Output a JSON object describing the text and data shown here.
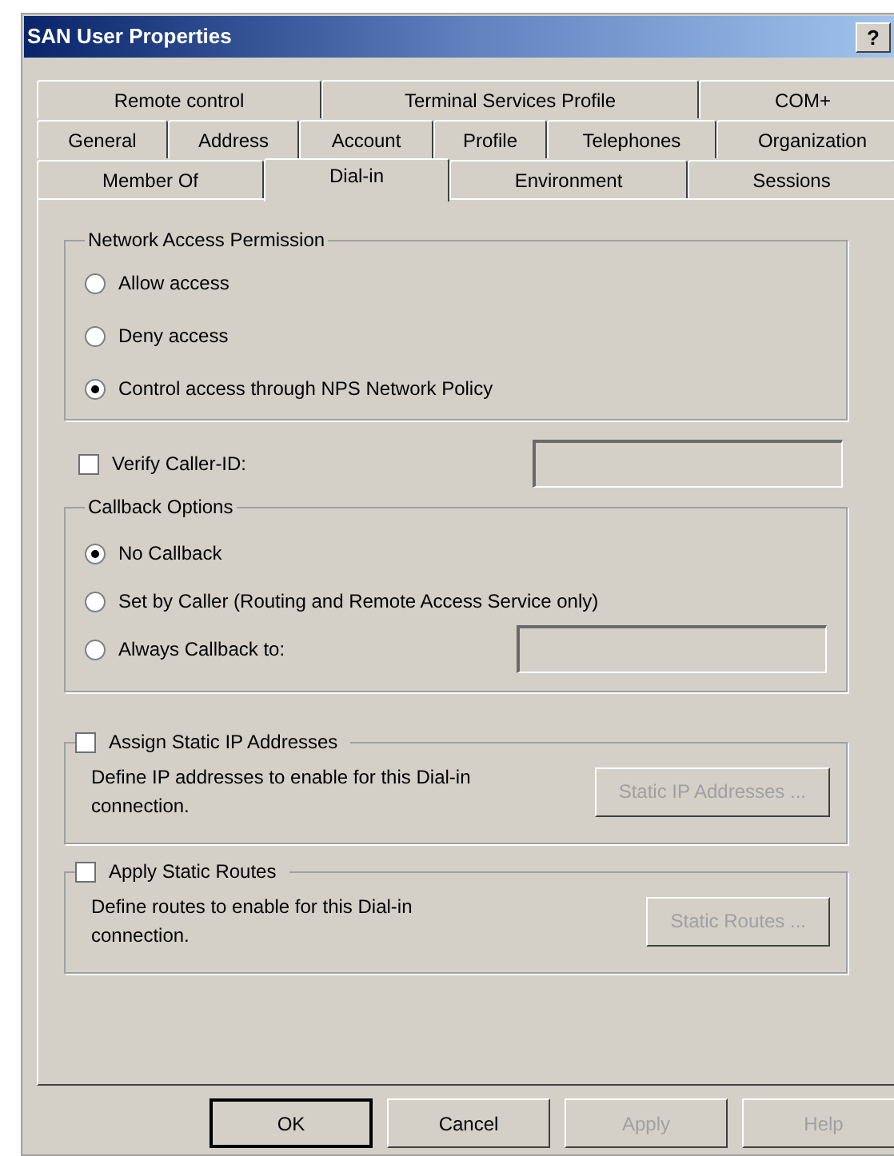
{
  "window": {
    "title": "SAN User Properties",
    "help_button": "?"
  },
  "tab_rows": [
    {
      "tabs": [
        {
          "label": "Remote control",
          "selected": false
        },
        {
          "label": "Terminal Services Profile",
          "selected": false
        },
        {
          "label": "COM+",
          "selected": false
        }
      ]
    },
    {
      "tabs": [
        {
          "label": "General",
          "selected": false
        },
        {
          "label": "Address",
          "selected": false
        },
        {
          "label": "Account",
          "selected": false
        },
        {
          "label": "Profile",
          "selected": false
        },
        {
          "label": "Telephones",
          "selected": false
        },
        {
          "label": "Organization",
          "selected": false
        }
      ]
    },
    {
      "tabs": [
        {
          "label": "Member Of",
          "selected": false
        },
        {
          "label": "Dial-in",
          "selected": true
        },
        {
          "label": "Environment",
          "selected": false
        },
        {
          "label": "Sessions",
          "selected": false
        }
      ]
    }
  ],
  "network_access_permission": {
    "title": "Network Access Permission",
    "options": [
      {
        "label": "Allow access",
        "selected": false
      },
      {
        "label": "Deny access",
        "selected": false
      },
      {
        "label": "Control access through NPS Network Policy",
        "selected": true
      }
    ]
  },
  "verify_caller_id": {
    "label": "Verify Caller-ID:",
    "checked": false,
    "field_disabled": true
  },
  "callback_options": {
    "title": "Callback Options",
    "options": [
      {
        "label": "No Callback",
        "selected": true,
        "has_field": false
      },
      {
        "label": "Set by Caller (Routing and Remote Access Service only)",
        "selected": false,
        "has_field": false
      },
      {
        "label": "Always Callback to:",
        "selected": false,
        "has_field": true
      }
    ]
  },
  "static_sections": [
    {
      "label": "Assign Static IP Addresses",
      "checked": false,
      "description": "Define IP addresses to enable for this Dial-in connection.",
      "button": {
        "label": "Static IP Addresses ...",
        "disabled": true
      }
    },
    {
      "label": "Apply Static Routes",
      "checked": false,
      "description": "Define routes to enable for this Dial-in connection.",
      "button": {
        "label": "Static Routes ...",
        "disabled": true
      }
    }
  ],
  "buttons": [
    {
      "label": "OK",
      "disabled": false,
      "default": true
    },
    {
      "label": "Cancel",
      "disabled": false,
      "default": false
    },
    {
      "label": "Apply",
      "disabled": true,
      "default": false
    },
    {
      "label": "Help",
      "disabled": true,
      "default": false
    }
  ]
}
